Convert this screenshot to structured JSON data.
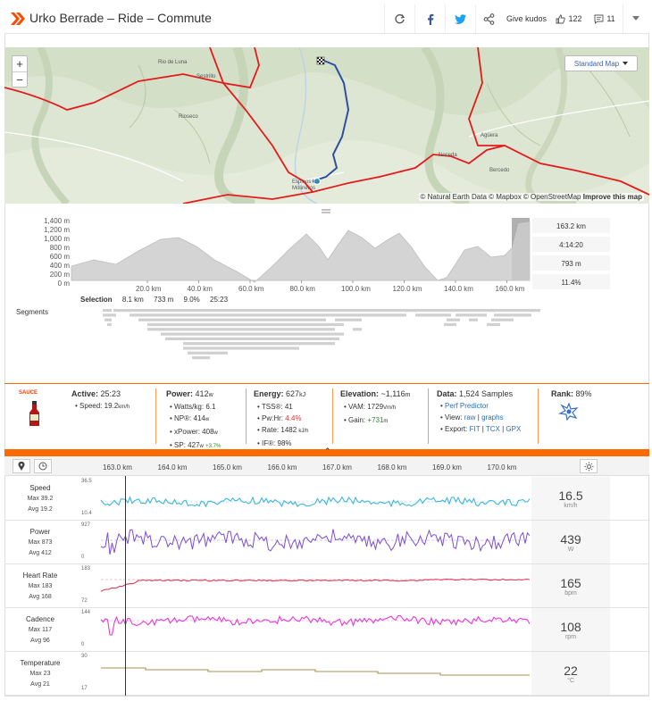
{
  "header": {
    "title": "Urko Berrade – Ride – Commute",
    "give_kudos": "Give kudos",
    "kudos_count": "122",
    "comments_count": "11"
  },
  "map": {
    "zoom_in": "+",
    "zoom_out": "−",
    "style_button": "Standard Map",
    "attribution_prefix": "© Natural Earth Data © Mapbox © OpenStreetMap",
    "attribution_link": "Improve this map",
    "labels": [
      "Rio de Luna",
      "Sestrillo",
      "Rioseco",
      "Espinos los Molineros",
      "Agüera",
      "Noceda",
      "Bercedo"
    ]
  },
  "elevation": {
    "y_ticks": [
      "1,400 m",
      "1,200 m",
      "1,000 m",
      "800 m",
      "600 m",
      "400 m",
      "200 m",
      "0 m"
    ],
    "x_ticks": [
      "20.0 km",
      "40.0 km",
      "60.0 km",
      "80.0 km",
      "100.0 km",
      "120.0 km",
      "140.0 km",
      "160.0 km"
    ],
    "stats": [
      "163.2 km",
      "4:14:20",
      "793 m",
      "11.4%"
    ],
    "selection": {
      "label": "Selection",
      "distance": "8.1 km",
      "elevation": "733 m",
      "grade": "9.0%",
      "time": "25:23"
    },
    "segments_label": "Segments"
  },
  "sauce": {
    "badge": "SAUCE",
    "active": {
      "label": "Active:",
      "value": "25:23",
      "speed_label": "Speed:",
      "speed": "19.2",
      "speed_unit": "km/h"
    },
    "power": {
      "label": "Power:",
      "value": "412",
      "unit": "w",
      "rows": [
        {
          "label": "Watts/kg:",
          "value": "6.1",
          "unit": ""
        },
        {
          "label": "NP®:",
          "value": "414",
          "unit": "w"
        },
        {
          "label": "xPower:",
          "value": "408",
          "unit": "w"
        },
        {
          "label": "SP:",
          "value": "427",
          "unit": "w",
          "extra": "+3.7%"
        }
      ]
    },
    "energy": {
      "label": "Energy:",
      "value": "627",
      "unit": "kJ",
      "rows": [
        {
          "label": "TSS®:",
          "value": "41"
        },
        {
          "label": "Pw:Hr:",
          "value": "4.4%"
        },
        {
          "label": "Rate:",
          "value": "1482",
          "unit": "kJ/h"
        },
        {
          "label": "IF®:",
          "value": "98%"
        }
      ]
    },
    "elevation": {
      "label": "Elevation:",
      "value": "~1,116",
      "unit": "m",
      "rows": [
        {
          "label": "VAM:",
          "value": "1729",
          "unit": "Vm/h"
        },
        {
          "label": "Gain:",
          "value": "+731",
          "unit": "m"
        }
      ]
    },
    "data": {
      "label": "Data:",
      "value": "1,524 Samples",
      "perf": "Perf Predictor",
      "view_label": "View:",
      "view_raw": "raw",
      "view_graphs": "graphs",
      "export_label": "Export:",
      "fit": "FIT",
      "tcx": "TCX",
      "gpx": "GPX"
    },
    "rank": {
      "label": "Rank:",
      "value": "89%"
    },
    "toggle": "⌃"
  },
  "streams": {
    "x_ticks": [
      "163.0 km",
      "164.0 km",
      "165.0 km",
      "166.0 km",
      "167.0 km",
      "168.0 km",
      "169.0 km",
      "170.0 km"
    ],
    "rows": [
      {
        "name": "Speed",
        "max": "Max 39.2",
        "avg": "Avg 19.2",
        "ytop": "36.5",
        "ybot": "10.4",
        "value": "16.5",
        "unit": "km/h",
        "color": "#3fb6dc"
      },
      {
        "name": "Power",
        "max": "Max 873",
        "avg": "Avg 412",
        "ytop": "927",
        "ybot": "0",
        "value": "439",
        "unit": "W",
        "color": "#7b4fd0"
      },
      {
        "name": "Heart Rate",
        "max": "Max 183",
        "avg": "Avg 168",
        "ytop": "183",
        "ybot": "72",
        "value": "165",
        "unit": "bpm",
        "color": "#e03a5a"
      },
      {
        "name": "Cadence",
        "max": "Max 117",
        "avg": "Avg 96",
        "ytop": "144",
        "ybot": "0",
        "value": "108",
        "unit": "rpm",
        "color": "#e43ad8"
      },
      {
        "name": "Temperature",
        "max": "Max 23",
        "avg": "Avg 21",
        "ytop": "30",
        "ybot": "17",
        "value": "22",
        "unit": "°C",
        "color": "#a89050"
      }
    ]
  }
}
